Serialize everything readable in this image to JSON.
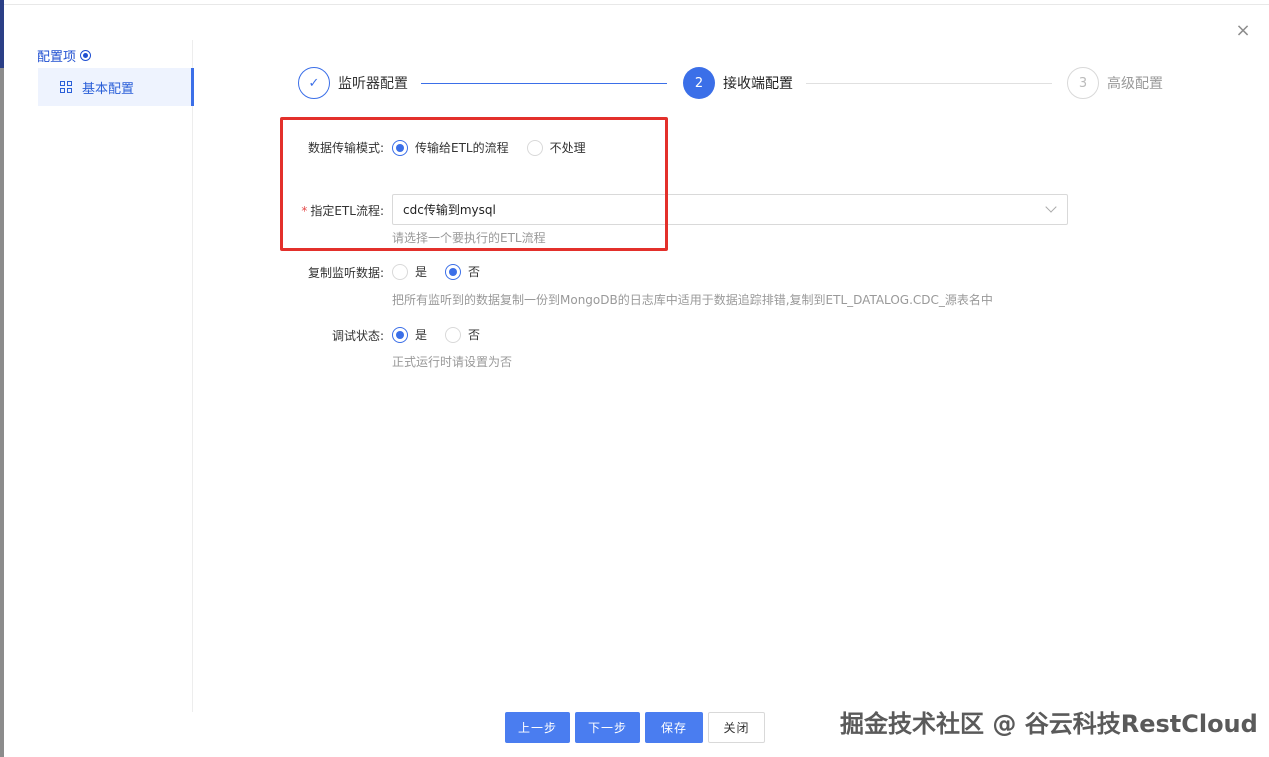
{
  "window": {
    "close_glyph": "×"
  },
  "sidebar": {
    "title": "配置项",
    "items": [
      {
        "label": "基本配置",
        "icon": "grid-icon"
      }
    ]
  },
  "steps": [
    {
      "label": "监听器配置",
      "marker": "✓",
      "status": "done"
    },
    {
      "label": "接收端配置",
      "marker": "2",
      "status": "active"
    },
    {
      "label": "高级配置",
      "marker": "3",
      "status": "pending"
    }
  ],
  "form": {
    "transfer_mode": {
      "label": "数据传输模式:",
      "options": [
        "传输给ETL的流程",
        "不处理"
      ],
      "selected": "传输给ETL的流程"
    },
    "etl_flow": {
      "required_mark": "*",
      "label": "指定ETL流程:",
      "value": "cdc传输到mysql",
      "help": "请选择一个要执行的ETL流程"
    },
    "copy_data": {
      "label": "复制监听数据:",
      "options": [
        "是",
        "否"
      ],
      "selected": "否",
      "help": "把所有监听到的数据复制一份到MongoDB的日志库中适用于数据追踪排错,复制到ETL_DATALOG.CDC_源表名中"
    },
    "debug": {
      "label": "调试状态:",
      "options": [
        "是",
        "否"
      ],
      "selected": "是",
      "help": "正式运行时请设置为否"
    }
  },
  "footer": {
    "prev": "上一步",
    "next": "下一步",
    "save": "保存",
    "close": "关闭"
  },
  "watermark": "掘金技术社区 @ 谷云科技RestCloud",
  "colors": {
    "primary": "#3b6fe8",
    "highlight": "#e3302b"
  }
}
